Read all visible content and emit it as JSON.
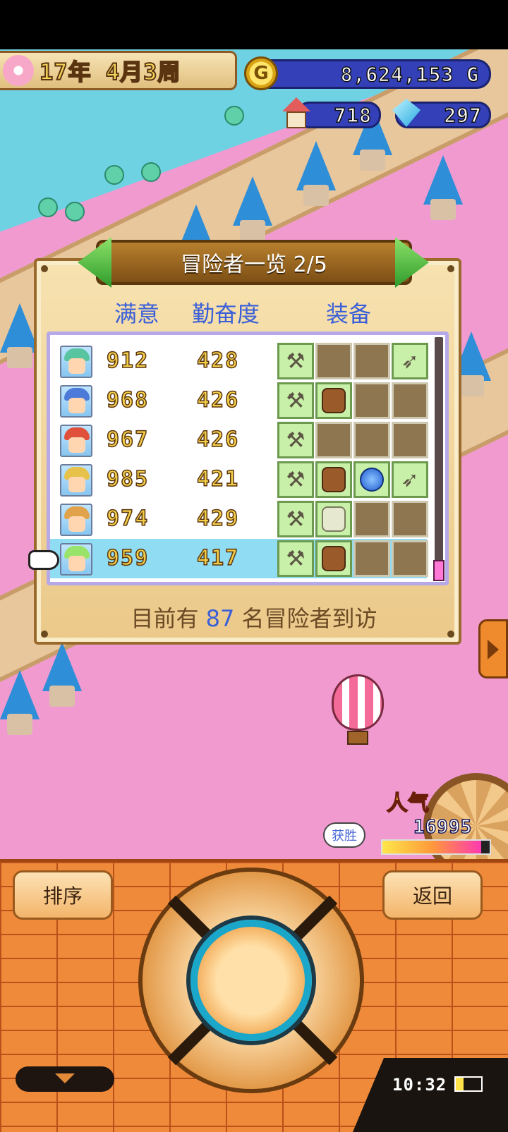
{
  "hud": {
    "date": "17年 4月3周",
    "gold": "8,624,153 G",
    "coin_symbol": "G",
    "population": "718",
    "gems": "297"
  },
  "dialog": {
    "title": "冒险者一览 2/5",
    "headers": {
      "satisfaction": "满意",
      "diligence": "勤奋度",
      "equipment": "装备"
    },
    "rows": [
      {
        "satisfaction": "912",
        "diligence": "428",
        "equip": [
          "axe",
          "empty",
          "empty",
          "spear"
        ],
        "hair": "#59c4a0"
      },
      {
        "satisfaction": "968",
        "diligence": "426",
        "equip": [
          "axe",
          "armor",
          "empty",
          "empty"
        ],
        "hair": "#4b7ad8"
      },
      {
        "satisfaction": "967",
        "diligence": "426",
        "equip": [
          "axe",
          "empty",
          "empty",
          "empty"
        ],
        "hair": "#e0503a"
      },
      {
        "satisfaction": "985",
        "diligence": "421",
        "equip": [
          "axe",
          "armor",
          "orb",
          "spear"
        ],
        "hair": "#e6c24a"
      },
      {
        "satisfaction": "974",
        "diligence": "429",
        "equip": [
          "axe",
          "armor-light",
          "empty",
          "empty"
        ],
        "hair": "#e0a24a"
      },
      {
        "satisfaction": "959",
        "diligence": "417",
        "equip": [
          "axe",
          "armor",
          "empty",
          "empty"
        ],
        "hair": "#9ae36b",
        "selected": true
      }
    ],
    "visitor_prefix": "目前有",
    "visitor_count": "87",
    "visitor_suffix": "名冒险者到访"
  },
  "popularity": {
    "label": "人气",
    "value": "16995",
    "level": 0.92
  },
  "bubble": "获胜",
  "buttons": {
    "sort": "排序",
    "back": "返回"
  },
  "status": {
    "time": "10:32",
    "battery_level": 0.3
  },
  "colors": {
    "accent_blue": "#3a5fd8",
    "gold_text": "#f2cf48"
  }
}
